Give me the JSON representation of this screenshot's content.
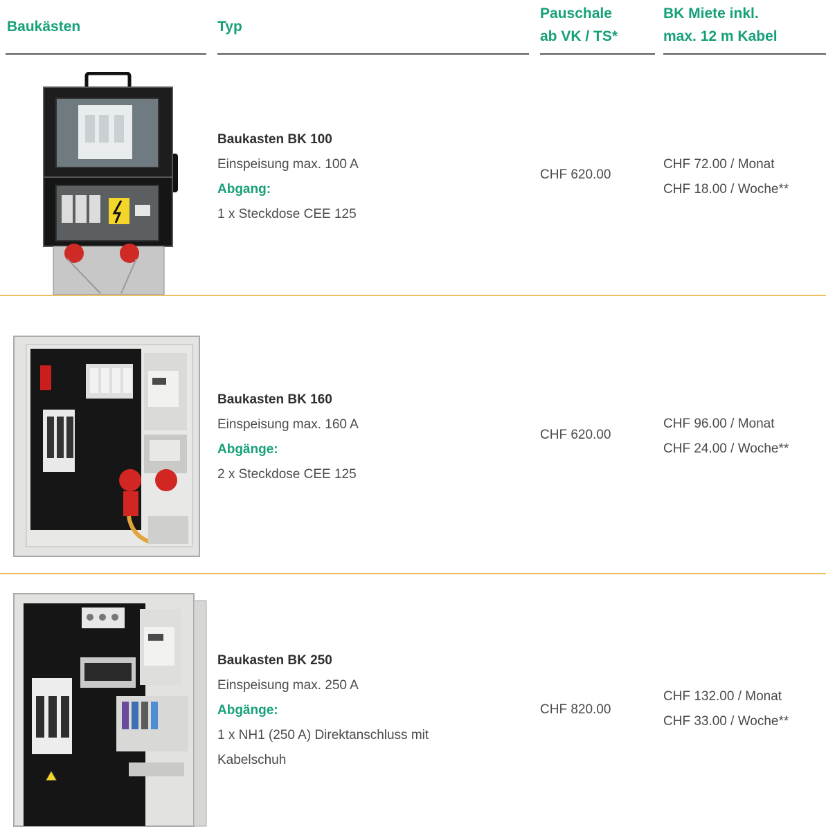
{
  "header": {
    "col1": "Baukästen",
    "col2": "Typ",
    "col3_line1": "Pauschale",
    "col3_line2": "ab VK / TS*",
    "col4_line1": "BK Miete inkl.",
    "col4_line2": "max. 12 m Kabel"
  },
  "colors": {
    "accent": "#16a07a",
    "separator": "#f2bf5e",
    "rule": "#595959"
  },
  "rows": [
    {
      "title": "Baukasten BK 100",
      "feed": "Einspeisung max. 100 A",
      "outlet_label": "Abgang:",
      "outlet_lines": [
        "1 x Steckdose CEE 125"
      ],
      "price": "CHF 620.00",
      "rent_month": "CHF 72.00 / Monat",
      "rent_week": "CHF 18.00 / Woche**"
    },
    {
      "title": "Baukasten BK 160",
      "feed": "Einspeisung max. 160 A",
      "outlet_label": "Abgänge:",
      "outlet_lines": [
        "2 x Steckdose CEE 125"
      ],
      "price": "CHF 620.00",
      "rent_month": "CHF 96.00 / Monat",
      "rent_week": "CHF 24.00 / Woche**"
    },
    {
      "title": "Baukasten BK 250",
      "feed": "Einspeisung max. 250 A",
      "outlet_label": "Abgänge:",
      "outlet_lines": [
        "1 x NH1 (250 A) Direktanschluss mit",
        "Kabelschuh"
      ],
      "price": "CHF 820.00",
      "rent_month": "CHF 132.00 / Monat",
      "rent_week": "CHF 33.00 / Woche**"
    }
  ]
}
